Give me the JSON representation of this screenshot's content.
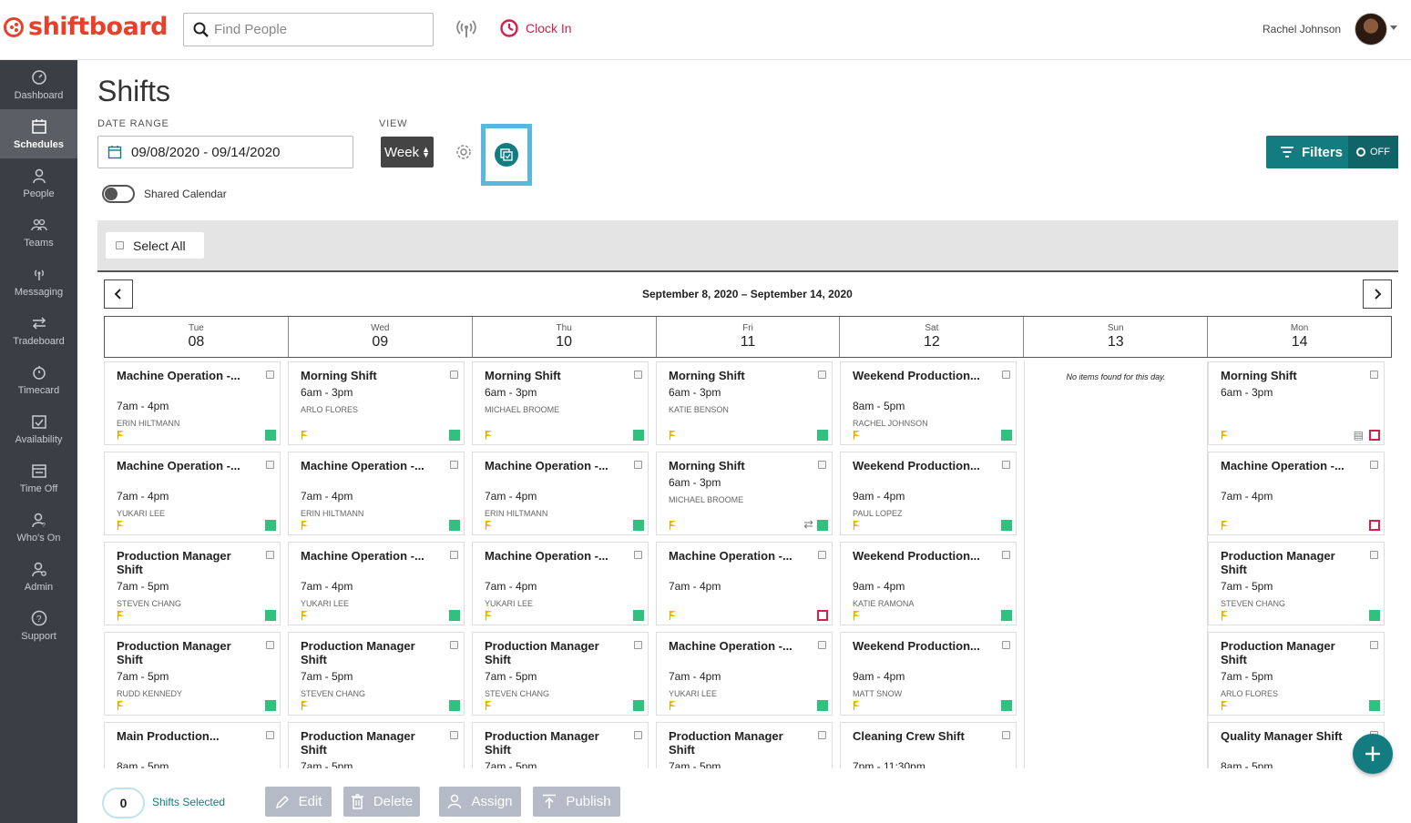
{
  "brand": {
    "name": "shiftboard",
    "color": "#e8402a"
  },
  "header": {
    "search_placeholder": "Find People",
    "clock_in_label": "Clock In",
    "user_name": "Rachel Johnson"
  },
  "sidebar": {
    "items": [
      {
        "label": "Dashboard",
        "icon": "dashboard-icon"
      },
      {
        "label": "Schedules",
        "icon": "calendar-icon",
        "active": true
      },
      {
        "label": "People",
        "icon": "person-icon"
      },
      {
        "label": "Teams",
        "icon": "teams-icon"
      },
      {
        "label": "Messaging",
        "icon": "broadcast-icon"
      },
      {
        "label": "Tradeboard",
        "icon": "swap-icon"
      },
      {
        "label": "Timecard",
        "icon": "stopwatch-icon"
      },
      {
        "label": "Availability",
        "icon": "availability-icon"
      },
      {
        "label": "Time Off",
        "icon": "time-off-icon"
      },
      {
        "label": "Who's On",
        "icon": "whos-on-icon"
      },
      {
        "label": "Admin",
        "icon": "admin-icon"
      },
      {
        "label": "Support",
        "icon": "help-icon"
      }
    ]
  },
  "page": {
    "title": "Shifts",
    "date_range_label": "DATE RANGE",
    "date_range_value": "09/08/2020 - 09/14/2020",
    "view_label": "VIEW",
    "view_value": "Week",
    "filters_label": "Filters",
    "filters_state": "OFF",
    "shared_calendar_label": "Shared Calendar",
    "select_all_label": "Select All",
    "calendar_title": "September 8, 2020 – September 14, 2020",
    "accent": "#137c81"
  },
  "days": [
    {
      "name": "Tue",
      "date": "08"
    },
    {
      "name": "Wed",
      "date": "09"
    },
    {
      "name": "Thu",
      "date": "10"
    },
    {
      "name": "Fri",
      "date": "11"
    },
    {
      "name": "Sat",
      "date": "12"
    },
    {
      "name": "Sun",
      "date": "13"
    },
    {
      "name": "Mon",
      "date": "14"
    }
  ],
  "no_items_text": "No items found for this day.",
  "shifts": {
    "tue": [
      {
        "title": "Machine Operation -...",
        "time": "7am - 4pm",
        "person": "ERIN HILTMANN",
        "status": "green"
      },
      {
        "title": "Machine Operation -...",
        "time": "7am - 4pm",
        "person": "YUKARI LEE",
        "status": "green"
      },
      {
        "title": "Production Manager Shift",
        "time": "7am - 5pm",
        "person": "STEVEN CHANG",
        "status": "green"
      },
      {
        "title": "Production Manager Shift",
        "time": "7am - 5pm",
        "person": "RUDD KENNEDY",
        "status": "green"
      },
      {
        "title": "Main Production...",
        "time": "8am - 5pm",
        "person": "",
        "status": "green"
      }
    ],
    "wed": [
      {
        "title": "Morning Shift",
        "time": "6am - 3pm",
        "person": "ARLO FLORES",
        "status": "green"
      },
      {
        "title": "Machine Operation -...",
        "time": "7am - 4pm",
        "person": "ERIN HILTMANN",
        "status": "green"
      },
      {
        "title": "Machine Operation -...",
        "time": "7am - 4pm",
        "person": "YUKARI LEE",
        "status": "green"
      },
      {
        "title": "Production Manager Shift",
        "time": "7am - 5pm",
        "person": "STEVEN CHANG",
        "status": "green"
      },
      {
        "title": "Production Manager Shift",
        "time": "7am - 5pm",
        "person": "",
        "status": "green"
      }
    ],
    "thu": [
      {
        "title": "Morning Shift",
        "time": "6am - 3pm",
        "person": "MICHAEL BROOME",
        "status": "green"
      },
      {
        "title": "Machine Operation -...",
        "time": "7am - 4pm",
        "person": "ERIN HILTMANN",
        "status": "green"
      },
      {
        "title": "Machine Operation -...",
        "time": "7am - 4pm",
        "person": "YUKARI LEE",
        "status": "green"
      },
      {
        "title": "Production Manager Shift",
        "time": "7am - 5pm",
        "person": "STEVEN CHANG",
        "status": "green"
      },
      {
        "title": "Production Manager Shift",
        "time": "7am - 5pm",
        "person": "",
        "status": "green"
      }
    ],
    "fri": [
      {
        "title": "Morning Shift",
        "time": "6am - 3pm",
        "person": "KATIE BENSON",
        "status": "green"
      },
      {
        "title": "Morning Shift",
        "time": "6am - 3pm",
        "person": "MICHAEL BROOME",
        "status": "green",
        "swap": true
      },
      {
        "title": "Machine Operation -...",
        "time": "7am - 4pm",
        "person": "",
        "status": "open"
      },
      {
        "title": "Machine Operation -...",
        "time": "7am - 4pm",
        "person": "YUKARI LEE",
        "status": "green"
      },
      {
        "title": "Production Manager Shift",
        "time": "7am - 5pm",
        "person": "",
        "status": "green"
      }
    ],
    "sat": [
      {
        "title": "Weekend Production...",
        "time": "8am - 5pm",
        "person": "RACHEL JOHNSON",
        "status": "green"
      },
      {
        "title": "Weekend Production...",
        "time": "9am - 4pm",
        "person": "PAUL LOPEZ",
        "status": "green"
      },
      {
        "title": "Weekend Production...",
        "time": "9am - 4pm",
        "person": "KATIE RAMONA",
        "status": "green"
      },
      {
        "title": "Weekend Production...",
        "time": "9am - 4pm",
        "person": "MATT SNOW",
        "status": "green"
      },
      {
        "title": "Cleaning Crew Shift",
        "time": "7pm - 11:30pm",
        "person": "",
        "status": "green"
      }
    ],
    "mon": [
      {
        "title": "Morning Shift",
        "time": "6am - 3pm",
        "person": "",
        "status": "open",
        "note": true
      },
      {
        "title": "Machine Operation -...",
        "time": "7am - 4pm",
        "person": "",
        "status": "open"
      },
      {
        "title": "Production Manager Shift",
        "time": "7am - 5pm",
        "person": "STEVEN CHANG",
        "status": "green"
      },
      {
        "title": "Production Manager Shift",
        "time": "7am - 5pm",
        "person": "ARLO FLORES",
        "status": "green"
      },
      {
        "title": "Quality Manager Shift",
        "time": "8am - 5pm",
        "person": "",
        "status": "green"
      }
    ]
  },
  "bottom": {
    "selected_count": "0",
    "shifts_selected_label": "Shifts Selected",
    "actions": [
      "Edit",
      "Delete",
      "Assign",
      "Publish"
    ]
  }
}
